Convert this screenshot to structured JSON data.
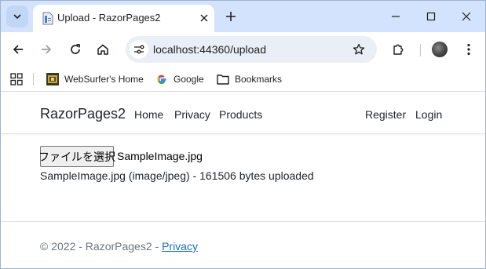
{
  "browser": {
    "tab_title": "Upload - RazorPages2",
    "url": "localhost:44360/upload",
    "bookmarks": [
      {
        "label": "WebSurfer's Home",
        "icon": "websurfer-favicon-icon"
      },
      {
        "label": "Google",
        "icon": "google-icon"
      },
      {
        "label": "Bookmarks",
        "icon": "folder-icon"
      }
    ]
  },
  "site": {
    "brand": "RazorPages2",
    "nav": [
      "Home",
      "Privacy",
      "Products"
    ],
    "nav_right": [
      "Register",
      "Login"
    ]
  },
  "upload": {
    "button_label": "ファイルを選択",
    "selected_file": "SampleImage.jpg",
    "result": "SampleImage.jpg (image/jpeg) - 161506 bytes uploaded"
  },
  "footer": {
    "copyright": "© 2022 - RazorPages2 - ",
    "privacy_link": "Privacy"
  },
  "colors": {
    "tabstrip": "#d3e3fd",
    "link": "#1b6ec2"
  }
}
